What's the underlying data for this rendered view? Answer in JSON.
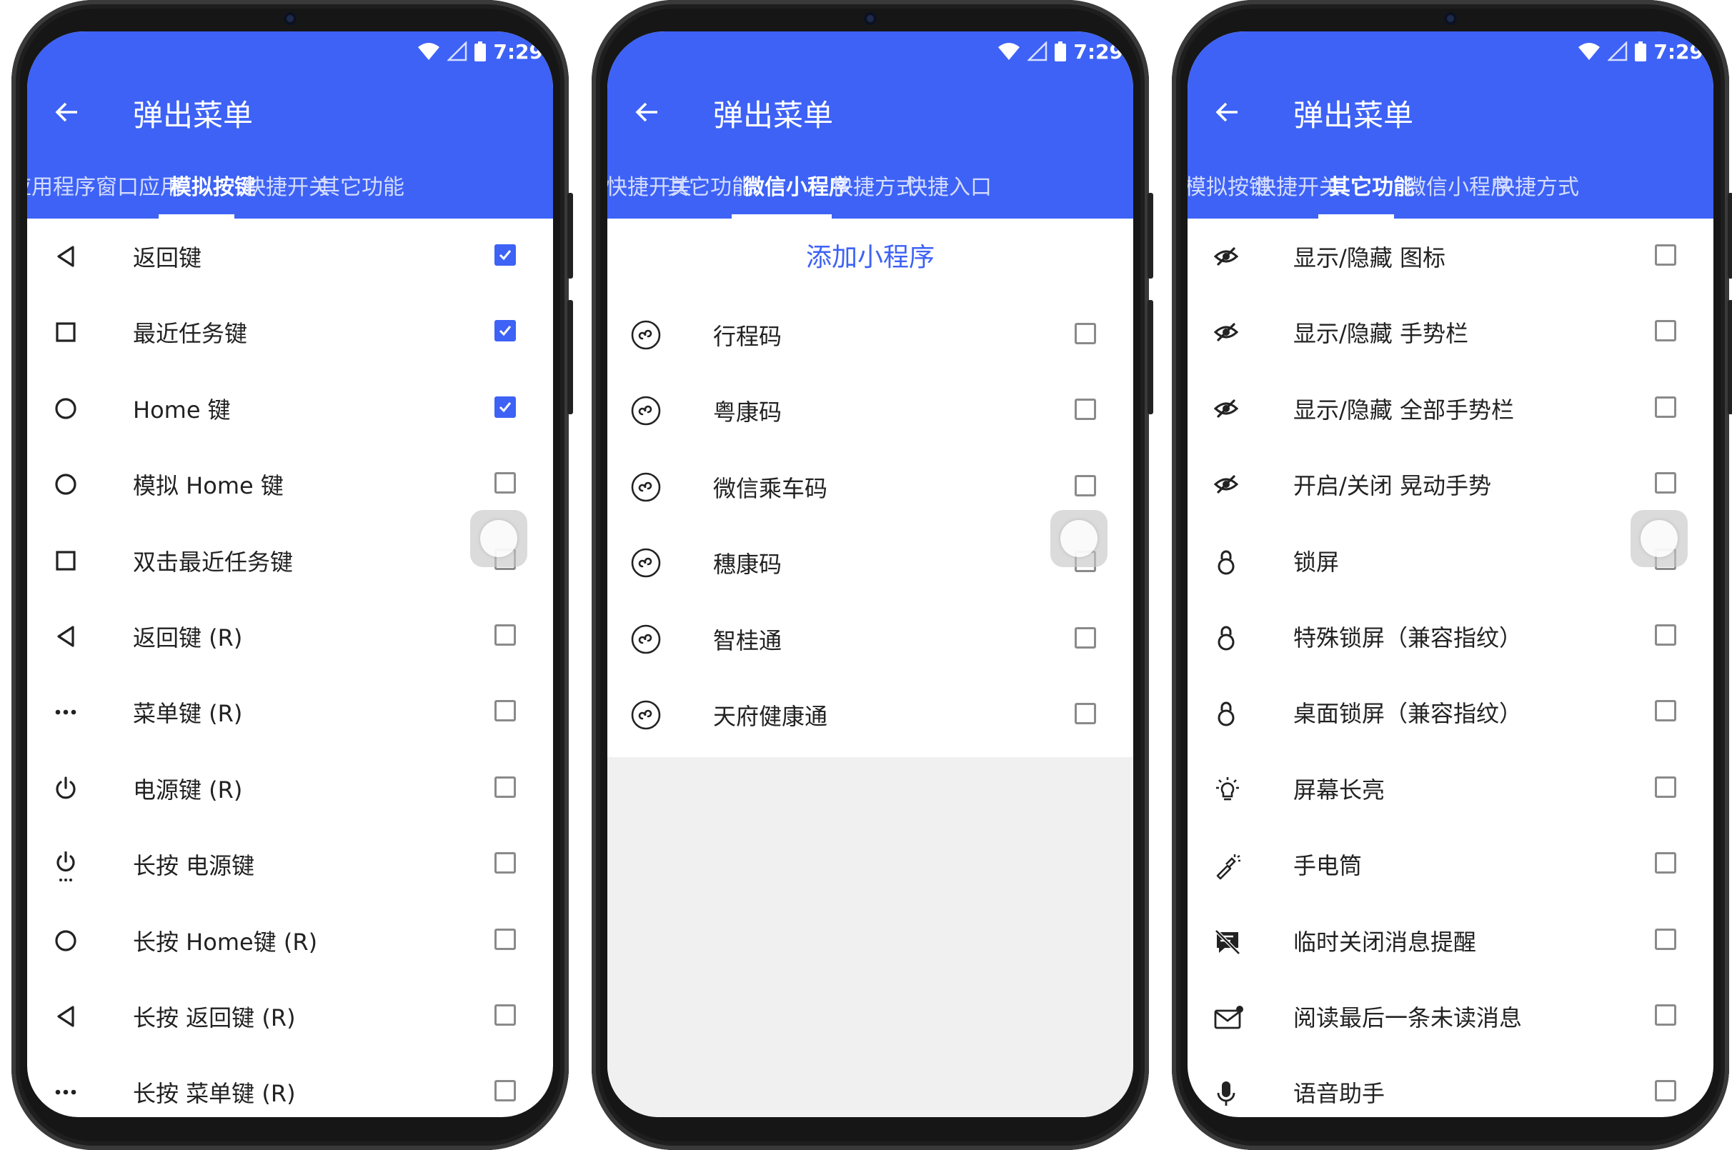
{
  "status": {
    "time": "7:29"
  },
  "colors": {
    "appbar": "#3d62f5",
    "accent": "#3d62f5",
    "checkbox_border": "#8a8a8a"
  },
  "phones": [
    {
      "title": "弹出菜单",
      "tabs": [
        {
          "label": "应用程序",
          "active": false
        },
        {
          "label": "窗口应用",
          "active": false
        },
        {
          "label": "模拟按键",
          "active": true
        },
        {
          "label": "快捷开关",
          "active": false
        },
        {
          "label": "其它功能",
          "active": false
        }
      ],
      "items": [
        {
          "icon": "back-triangle-icon",
          "label": "返回键",
          "checked": true
        },
        {
          "icon": "square-icon",
          "label": "最近任务键",
          "checked": true
        },
        {
          "icon": "circle-icon",
          "label": "Home 键",
          "checked": true
        },
        {
          "icon": "circle-icon",
          "label": "模拟 Home 键",
          "checked": false
        },
        {
          "icon": "square-icon",
          "label": "双击最近任务键",
          "checked": false
        },
        {
          "icon": "back-triangle-icon",
          "label": "返回键 (R)",
          "checked": false
        },
        {
          "icon": "dots-icon",
          "label": "菜单键 (R)",
          "checked": false
        },
        {
          "icon": "power-icon",
          "label": "电源键 (R)",
          "checked": false
        },
        {
          "icon": "power-long-icon",
          "label": "长按 电源键",
          "checked": false
        },
        {
          "icon": "circle-icon",
          "label": "长按 Home键 (R)",
          "checked": false
        },
        {
          "icon": "back-triangle-icon",
          "label": "长按 返回键 (R)",
          "checked": false
        },
        {
          "icon": "dots-icon",
          "label": "长按 菜单键 (R)",
          "checked": false
        }
      ]
    },
    {
      "title": "弹出菜单",
      "tabs": [
        {
          "label": "快捷开关",
          "active": false
        },
        {
          "label": "其它功能",
          "active": false
        },
        {
          "label": "微信小程序",
          "active": true
        },
        {
          "label": "快捷方式",
          "active": false
        },
        {
          "label": "快捷入口",
          "active": false
        }
      ],
      "add_button": "添加小程序",
      "items": [
        {
          "icon": "mini-program-icon",
          "label": "行程码",
          "checked": false
        },
        {
          "icon": "mini-program-icon",
          "label": "粤康码",
          "checked": false
        },
        {
          "icon": "mini-program-icon",
          "label": "微信乘车码",
          "checked": false
        },
        {
          "icon": "mini-program-icon",
          "label": "穗康码",
          "checked": false
        },
        {
          "icon": "mini-program-icon",
          "label": "智桂通",
          "checked": false
        },
        {
          "icon": "mini-program-icon",
          "label": "天府健康通",
          "checked": false
        }
      ]
    },
    {
      "title": "弹出菜单",
      "tabs": [
        {
          "label": "模拟按键",
          "active": false
        },
        {
          "label": "快捷开关",
          "active": false
        },
        {
          "label": "其它功能",
          "active": true
        },
        {
          "label": "微信小程序",
          "active": false
        },
        {
          "label": "快捷方式",
          "active": false
        }
      ],
      "items": [
        {
          "icon": "eye-off-icon",
          "label": "显示/隐藏 图标",
          "checked": false
        },
        {
          "icon": "eye-off-icon",
          "label": "显示/隐藏 手势栏",
          "checked": false
        },
        {
          "icon": "eye-off-icon",
          "label": "显示/隐藏 全部手势栏",
          "checked": false
        },
        {
          "icon": "eye-off-icon",
          "label": "开启/关闭 晃动手势",
          "checked": false
        },
        {
          "icon": "lock-icon",
          "label": "锁屏",
          "checked": false
        },
        {
          "icon": "lock-icon",
          "label": "特殊锁屏（兼容指纹）",
          "checked": false
        },
        {
          "icon": "lock-icon",
          "label": "桌面锁屏（兼容指纹）",
          "checked": false
        },
        {
          "icon": "bulb-icon",
          "label": "屏幕长亮",
          "checked": false
        },
        {
          "icon": "flashlight-icon",
          "label": "手电筒",
          "checked": false
        },
        {
          "icon": "notification-off-icon",
          "label": "临时关闭消息提醒",
          "checked": false
        },
        {
          "icon": "mail-icon",
          "label": "阅读最后一条未读消息",
          "checked": false
        },
        {
          "icon": "mic-icon",
          "label": "语音助手",
          "checked": false
        }
      ]
    }
  ]
}
